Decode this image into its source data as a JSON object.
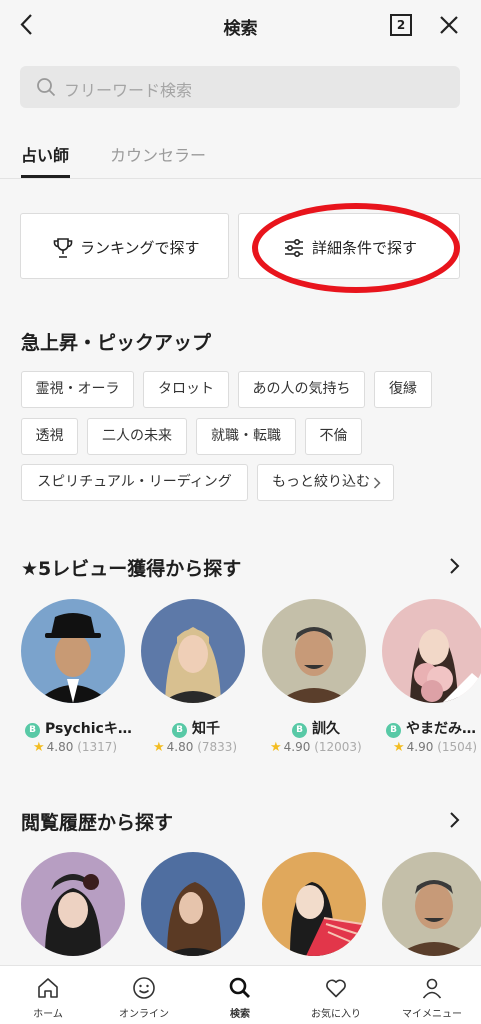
{
  "header": {
    "title": "検索",
    "tab_count": "2"
  },
  "search": {
    "placeholder": "フリーワード検索"
  },
  "tabs": [
    {
      "label": "占い師",
      "active": true
    },
    {
      "label": "カウンセラー",
      "active": false
    }
  ],
  "buttons": {
    "ranking": "ランキングで探す",
    "detail": "詳細条件で探す"
  },
  "pickup": {
    "title": "急上昇・ピックアップ",
    "chips": [
      "霊視・オーラ",
      "タロット",
      "あの人の気持ち",
      "復縁",
      "透視",
      "二人の未来",
      "就職・転職",
      "不倫",
      "スピリチュアル・リーディング"
    ],
    "more_label": "もっと絞り込む"
  },
  "reviews": {
    "title": "★5レビュー獲得から探す",
    "people": [
      {
        "badge": "B",
        "name": "Psychicキ…",
        "rating": "4.80",
        "count": "(1317)"
      },
      {
        "badge": "B",
        "name": "知千",
        "rating": "4.80",
        "count": "(7833)"
      },
      {
        "badge": "B",
        "name": "訓久",
        "rating": "4.90",
        "count": "(12003)"
      },
      {
        "badge": "B",
        "name": "やまだみ…",
        "rating": "4.90",
        "count": "(1504)"
      }
    ]
  },
  "history": {
    "title": "閲覧履歴から探す"
  },
  "nav": [
    {
      "label": "ホーム",
      "icon": "home-icon"
    },
    {
      "label": "オンライン",
      "icon": "smiley-icon"
    },
    {
      "label": "検索",
      "icon": "search-icon",
      "active": true
    },
    {
      "label": "お気に入り",
      "icon": "heart-icon"
    },
    {
      "label": "マイメニュー",
      "icon": "person-icon"
    }
  ],
  "colors": {
    "accent_red": "#e8141c",
    "badge_green": "#58c9a6",
    "star": "#f3bd22",
    "background": "#f6f6f6"
  }
}
